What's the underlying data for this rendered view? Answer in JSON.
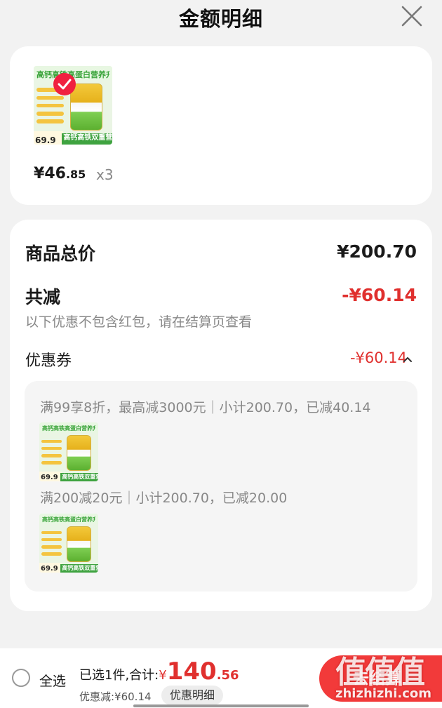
{
  "header": {
    "title": "金额明细"
  },
  "product": {
    "image_title": "高钙高铁高蛋白营养升级",
    "image_badge_price": "69.9",
    "image_bottom_text": "高钙高铁双重营养",
    "price_symbol": "¥",
    "price_int": "46",
    "price_dec": ".85",
    "quantity": "x3"
  },
  "summary": {
    "total_label": "商品总价",
    "total_value": "¥200.70",
    "reduce_label": "共减",
    "reduce_value": "-¥60.14",
    "note": "以下优惠不包含红包，请在结算页查看",
    "coupon_label": "优惠券",
    "coupon_value": "-¥60.14"
  },
  "coupon_rules": [
    {
      "text": "满99享8折，最高减3000元｜小计200.70，已减40.14"
    },
    {
      "text": "满200减20元｜小计200.70，已减20.00"
    }
  ],
  "footer": {
    "select_all": "全选",
    "selected_label": "已选1件,合计:",
    "currency": "¥",
    "total_int": "140",
    "total_dec": ".56",
    "discount_text": "优惠减:¥60.14",
    "detail_button": "优惠明细",
    "checkout_button": "去结算"
  },
  "watermark": {
    "logo": "值值值",
    "url": "zhizhizhi.com"
  },
  "colors": {
    "accent_red": "#e0302e",
    "button_red": "#f23a3a",
    "background": "#f2f2f2"
  },
  "icons": {
    "close": "close-icon",
    "check": "check-badge-icon",
    "collapse": "chevron-up-icon"
  }
}
